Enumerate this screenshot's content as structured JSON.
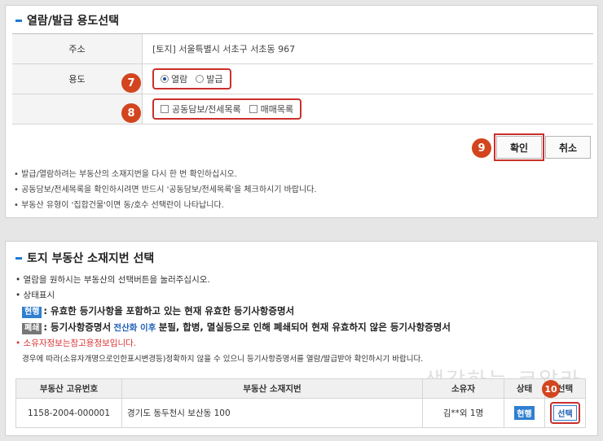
{
  "section1": {
    "title": "열람/발급 용도선택",
    "address_label": "주소",
    "address_value": "[토지] 서울특별시 서초구 서초동 967",
    "purpose_label": "용도",
    "radio_view": "열람",
    "radio_issue": "발급",
    "radio_selected": "열람",
    "check_joint": "공동담보/전세목록",
    "check_trade": "매매목록",
    "confirm_button": "확인",
    "cancel_button": "취소",
    "notes": [
      "발급/열람하려는 부동산의 소재지번을 다시 한 번 확인하십시오.",
      "공동담보/전세목록을 확인하시려면 반드시 '공동담보/전세목록'을 체크하시기 바랍니다.",
      "부동산 유형이 '집합건물'이면 동/호수 선택란이 나타납니다."
    ],
    "step_badges": {
      "s7": "7",
      "s8": "8",
      "s9": "9"
    }
  },
  "section2": {
    "title": "토지 부동산 소재지번 선택",
    "line1": "열람을 원하시는 부동산의 선택버튼을 눌러주십시오.",
    "line2": "상태표시",
    "tag_current": "현행",
    "line3_text": ": 유효한 등기사항을 포함하고 있는 현재 유효한 등기사항증명서",
    "tag_closed": "폐쇄",
    "line4_pre": ": 등기사항증명서",
    "line4_highlight": "전산화 이후",
    "line4_post": "분필, 합병, 멸실등으로 인해 폐쇄되어 현재 유효하지 않은 등기사항증명서",
    "red_line": "소유자정보는참고용정보입니다.",
    "info_line": "경우에 따라(소유자개명으로인한표시변경등)정확하지 않을 수 있으니 등기사항증명서를 열람/발급받아 확인하시기 바랍니다.",
    "watermark": "생각하는 코알라",
    "step_badge": "10",
    "table": {
      "headers": [
        "부동산 고유번호",
        "부동산 소재지번",
        "소유자",
        "상태",
        "선택"
      ],
      "row": {
        "id": "1158-2004-000001",
        "address": "경기도 동두천시 보산동 100",
        "owner": "김**외 1명",
        "status": "현행",
        "select": "선택"
      }
    }
  },
  "colors": {
    "accent": "#1c7ad6",
    "badge": "#d2451e",
    "highlight_border": "#c9302c"
  }
}
